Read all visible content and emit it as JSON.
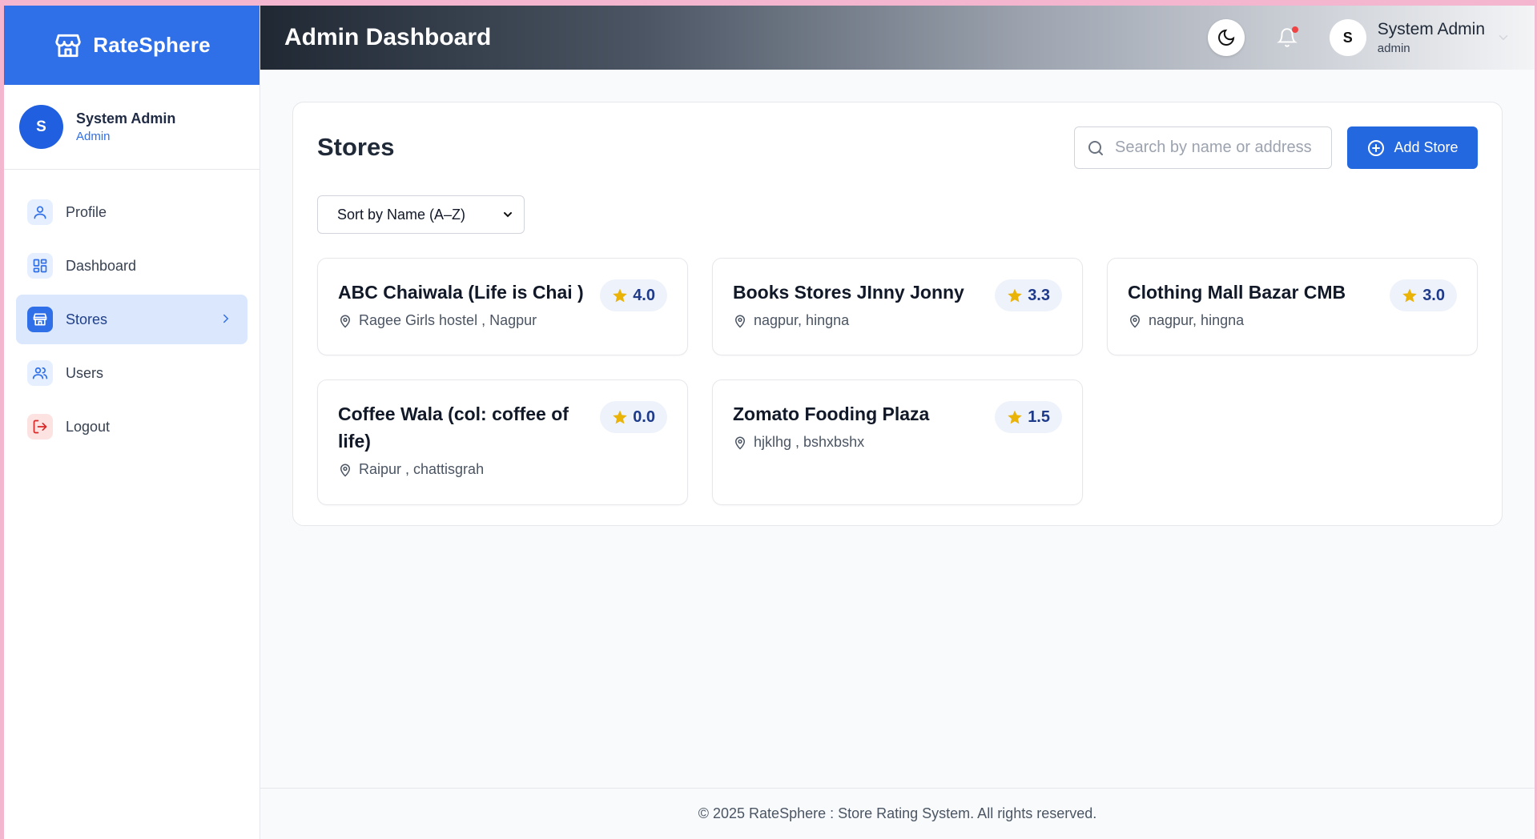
{
  "brand": {
    "name": "RateSphere",
    "color": "#2f6fe8"
  },
  "sidebar": {
    "user": {
      "initial": "S",
      "name": "System Admin",
      "role": "Admin"
    },
    "items": [
      {
        "label": "Profile",
        "icon": "user-icon"
      },
      {
        "label": "Dashboard",
        "icon": "grid-icon"
      },
      {
        "label": "Stores",
        "icon": "store-icon",
        "active": true
      },
      {
        "label": "Users",
        "icon": "users-icon"
      },
      {
        "label": "Logout",
        "icon": "logout-icon"
      }
    ]
  },
  "header": {
    "title": "Admin Dashboard",
    "user": {
      "initial": "S",
      "name": "System Admin",
      "role": "admin"
    }
  },
  "stores": {
    "title": "Stores",
    "search_placeholder": "Search by name or address",
    "add_label": "Add Store",
    "sort_value": "Sort by Name (A–Z)",
    "list": [
      {
        "name": "ABC Chaiwala (Life is Chai )",
        "rating": "4.0",
        "address": "Ragee Girls hostel , Nagpur"
      },
      {
        "name": "Books Stores JInny Jonny",
        "rating": "3.3",
        "address": "nagpur, hingna"
      },
      {
        "name": "Clothing Mall Bazar CMB",
        "rating": "3.0",
        "address": "nagpur, hingna"
      },
      {
        "name": "Coffee Wala (col: coffee of life)",
        "rating": "0.0",
        "address": "Raipur , chattisgrah"
      },
      {
        "name": "Zomato Fooding Plaza",
        "rating": "1.5",
        "address": "hjklhg , bshxbshx"
      }
    ]
  },
  "footer": {
    "text": "© 2025 RateSphere : Store Rating System. All rights reserved."
  },
  "colors": {
    "accent": "#2468e0",
    "star": "#eab308",
    "notification": "#ef4444"
  }
}
